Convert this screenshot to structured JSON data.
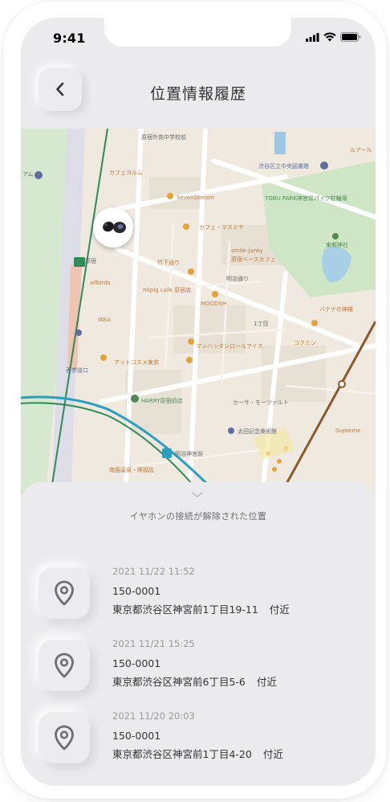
{
  "status_bar": {
    "time": "9:41"
  },
  "header": {
    "title": "位置情報履歴"
  },
  "map": {
    "labels": {
      "harajuku": "原宿",
      "omotesando_exit": "表参道口",
      "meiji_jingumae": "明治神宮前",
      "tobu_park": "TOBU PARK神宮前パイク駐輪場",
      "seven_stream": "SevenStream",
      "cafe_yorumu": "カフェヨルム",
      "cafe_masamiya": "カフェ・マスミヤ",
      "smile_junky": "smile-junky",
      "harajuku_base_cafe": "原宿ベースカフェ",
      "takeshita": "竹下通り",
      "mipig": "mipig cafe 原宿店",
      "moodsh": "MOODSH",
      "allbirds": "allbirds",
      "ikea": "IKEA",
      "banana": "バナナの神様",
      "kokumin": "コクミン",
      "manhattan": "マンハッタンロールアイス",
      "atcosme": "アットコスメ東京",
      "harry": "HARRY原宿前店",
      "carsa": "カーサ・モーツァルト",
      "ota": "太田記念美術館",
      "tougou": "東郷神社",
      "chome1": "1丁目",
      "supreme": "Supreme",
      "shibuya_lib": "渋谷区立中央図書館",
      "nanmon": "南園温泉・眼福店",
      "ruaru": "ルアール",
      "am": "アム",
      "meiji_dori": "明治通り",
      "ryokuchi": "原宿外苑中学校前"
    }
  },
  "sheet": {
    "title": "イヤホンの接続が解除された位置",
    "items": [
      {
        "date": "2021 11/22 11:52",
        "zip": "150-0001",
        "address": "東京都渋谷区神宮前1丁目19-11",
        "suffix": "付近"
      },
      {
        "date": "2021 11/21 15:25",
        "zip": "150-0001",
        "address": "東京都渋谷区神宮前6丁目5-6",
        "suffix": "付近"
      },
      {
        "date": "2021 11/20 20:03",
        "zip": "150-0001",
        "address": "東京都渋谷区神宮前1丁目4-20",
        "suffix": "付近"
      }
    ]
  },
  "icons": {
    "back": "chevron-left-icon",
    "pin": "location-pin-icon",
    "handle": "chevron-down-icon"
  },
  "colors": {
    "background": "#ebebed",
    "map_base": "#efe9e0",
    "park": "#cfe6c6",
    "rail_green": "#2e8b57",
    "rail_blue": "#2a9fbf",
    "rail_brown": "#8b5a2b"
  }
}
